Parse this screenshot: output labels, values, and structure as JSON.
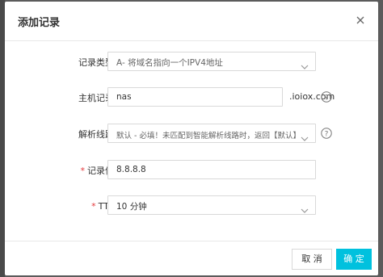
{
  "dialog": {
    "title": "添加记录"
  },
  "form": {
    "record_type": {
      "label": "记录类型：",
      "value": "A- 将域名指向一个IPV4地址"
    },
    "host_record": {
      "label": "主机记录：",
      "value": "nas",
      "suffix": ".ioiox.com"
    },
    "resolve_line": {
      "label": "解析线路：",
      "value": "默认 - 必填！未匹配到智能解析线路时，返回【默认】线路..."
    },
    "record_value": {
      "required_mark": "*",
      "label": "记录值：",
      "value": "8.8.8.8"
    },
    "ttl": {
      "required_mark": "*",
      "label": "TTL：",
      "value": "10 分钟"
    }
  },
  "footer": {
    "cancel_label": "取 消",
    "ok_label": "确 定"
  },
  "colors": {
    "primary": "#00c1de",
    "required": "#e4393c"
  }
}
